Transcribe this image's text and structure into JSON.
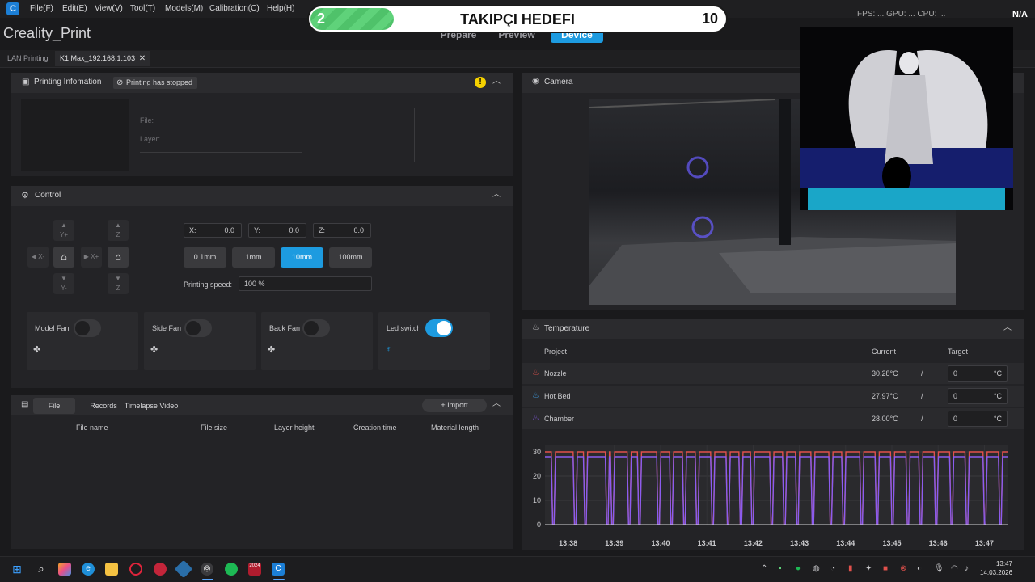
{
  "menu": {
    "logo": "C",
    "items": [
      "File(F)",
      "Edit(E)",
      "View(V)",
      "Tool(T)",
      "Models(M)",
      "Calibration(C)",
      "Help(H)"
    ]
  },
  "app_title": "Creality_Print",
  "mode_tabs": [
    "Prepare",
    "Preview",
    "Device"
  ],
  "goal_overlay": {
    "start": "2",
    "title": "TAKIPÇI HEDEFI",
    "end": "10",
    "progress": 0.2
  },
  "top_right": {
    "partial_stats": "FPS: ... GPU: ... CPU: ...",
    "na": "N/A"
  },
  "device_tabs": [
    "LAN Printing",
    "K1 Max_192.168.1.103"
  ],
  "print_info": {
    "title": "Printing Infomation",
    "status": "Printing has stopped",
    "file_label": "File:",
    "layer_label": "Layer:"
  },
  "control": {
    "title": "Control",
    "jog": {
      "y_plus": "Y+",
      "y_minus": "Y-",
      "x_minus": "X-",
      "x_plus": "X+",
      "z_up": "Z",
      "z_down": "Z"
    },
    "coords": [
      {
        "axis": "X:",
        "value": "0.0"
      },
      {
        "axis": "Y:",
        "value": "0.0"
      },
      {
        "axis": "Z:",
        "value": "0.0"
      }
    ],
    "steps": [
      "0.1mm",
      "1mm",
      "10mm",
      "100mm"
    ],
    "active_step": "10mm",
    "speed_label": "Printing speed:",
    "speed_value": "100 %",
    "fans": [
      {
        "label": "Model Fan",
        "on": false
      },
      {
        "label": "Side Fan",
        "on": false
      },
      {
        "label": "Back Fan",
        "on": false
      },
      {
        "label": "Led switch",
        "on": true
      }
    ]
  },
  "files": {
    "tabs": [
      "File",
      "Records",
      "Timelapse Video"
    ],
    "import_label": "Import",
    "columns": [
      "File name",
      "File size",
      "Layer height",
      "Creation time",
      "Material length"
    ]
  },
  "camera": {
    "title": "Camera"
  },
  "temperature": {
    "title": "Temperature",
    "headers": {
      "project": "Project",
      "current": "Current",
      "target": "Target"
    },
    "rows": [
      {
        "name": "Nozzle",
        "current": "30.28°C",
        "sep": "/",
        "target": "0",
        "unit": "°C",
        "color": "#e2514c"
      },
      {
        "name": "Hot Bed",
        "current": "27.97°C",
        "sep": "/",
        "target": "0",
        "unit": "°C",
        "color": "#3fa0e6"
      },
      {
        "name": "Chamber",
        "current": "28.00°C",
        "sep": "/",
        "target": "0",
        "unit": "°C",
        "color": "#8a5cf0"
      }
    ]
  },
  "chart_data": {
    "type": "line",
    "title": "",
    "xlabel": "",
    "ylabel": "",
    "x_ticks": [
      "13:38",
      "13:39",
      "13:40",
      "13:41",
      "13:42",
      "13:43",
      "13:44",
      "13:45",
      "13:46",
      "13:47"
    ],
    "y_ticks": [
      0,
      10,
      20,
      30
    ],
    "ylim": [
      0,
      33
    ],
    "series": [
      {
        "color": "#e2514c",
        "description": "nozzle",
        "values_note": "mostly 30 with drops"
      },
      {
        "color": "#8a5cf0",
        "description": "chamber",
        "values_note": "mostly 28 with drops to 0"
      }
    ],
    "drop_minutes": [
      13.36,
      13.53,
      13.61,
      13.78,
      13.82,
      13.95,
      14.03,
      14.18,
      14.28,
      14.38,
      14.48,
      14.6,
      14.72,
      14.82,
      14.91,
      15.06,
      15.16,
      15.26,
      15.38,
      15.52,
      15.62,
      15.76,
      15.88,
      16.0,
      16.12,
      16.22,
      16.34,
      16.46,
      16.58,
      16.72,
      16.84
    ],
    "x_range_minutes": [
      37.5,
      47.5
    ]
  },
  "taskbar": {
    "clock_time": "13:47",
    "clock_date": "14.03.2026",
    "app_badge": "2024"
  }
}
